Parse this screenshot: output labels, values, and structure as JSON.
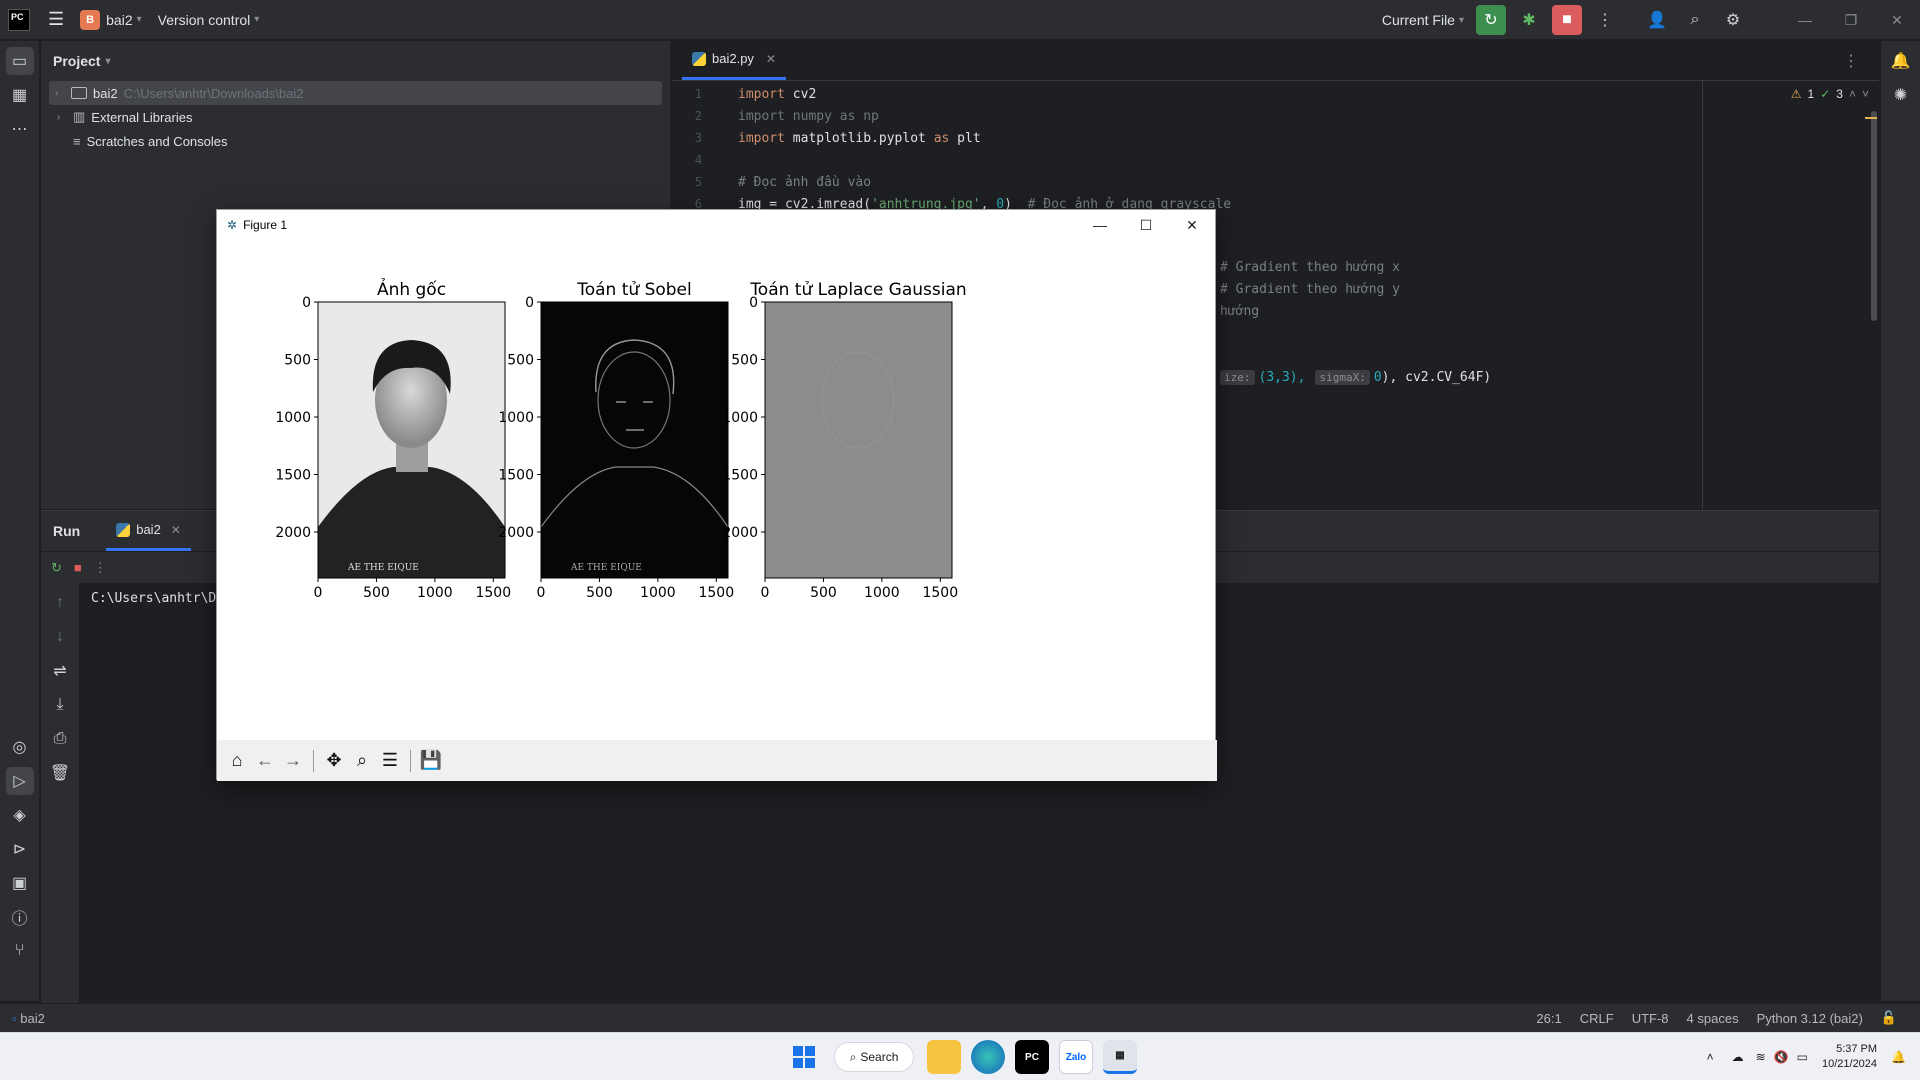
{
  "titlebar": {
    "project_badge": "B",
    "project_name": "bai2",
    "vcs": "Version control",
    "run_config": "Current File"
  },
  "project_panel": {
    "title": "Project",
    "items": [
      {
        "label": "bai2",
        "path": "C:\\Users\\anhtr\\Downloads\\bai2"
      },
      {
        "label": "External Libraries"
      },
      {
        "label": "Scratches and Consoles"
      }
    ]
  },
  "editor": {
    "tab": "bai2.py",
    "inspections": {
      "warnings": "1",
      "ok": "3"
    },
    "lines": [
      {
        "n": "1",
        "parts": [
          [
            "kw",
            "import"
          ],
          [
            "plain",
            " cv2"
          ]
        ]
      },
      {
        "n": "2",
        "parts": [
          [
            "dim",
            "import numpy as np"
          ]
        ]
      },
      {
        "n": "3",
        "parts": [
          [
            "kw",
            "import"
          ],
          [
            "plain",
            " matplotlib.pyplot "
          ],
          [
            "kw",
            "as"
          ],
          [
            "plain",
            " plt"
          ]
        ]
      },
      {
        "n": "4",
        "parts": []
      },
      {
        "n": "5",
        "parts": [
          [
            "cm",
            "# Đọc ảnh đầu vào"
          ]
        ]
      },
      {
        "n": "6",
        "parts": [
          [
            "plain",
            "img = cv2.imread("
          ],
          [
            "str",
            "'anhtrung.jpg'"
          ],
          [
            "plain",
            ", "
          ],
          [
            "num",
            "0"
          ],
          [
            "plain",
            ")  "
          ],
          [
            "cm",
            "# Đọc ảnh ở dạng grayscale"
          ]
        ]
      }
    ],
    "hidden_fragments": {
      "gx_comment": "# Gradient theo hướng x",
      "gy_comment": "# Gradient theo hướng y",
      "dir_comment": "hướng",
      "ksize_hint": "ize:",
      "ksize_val": "(3,3),",
      "sigma_hint": "sigmaX:",
      "sigma_tail_num": "0",
      "sigma_tail": "), cv2.CV_64F)"
    }
  },
  "run_panel": {
    "title": "Run",
    "tab": "bai2",
    "output": "C:\\Users\\anhtr\\D"
  },
  "figure": {
    "window_title": "Figure 1",
    "chart_data": [
      {
        "type": "image",
        "title": "Ảnh gốc",
        "xticks": [
          "0",
          "500",
          "1000",
          "1500"
        ],
        "yticks": [
          "0",
          "500",
          "1000",
          "1500",
          "2000"
        ],
        "xlim": [
          0,
          1600
        ],
        "ylim": [
          2400,
          0
        ]
      },
      {
        "type": "image",
        "title": "Toán tử Sobel",
        "xticks": [
          "0",
          "500",
          "1000",
          "1500"
        ],
        "yticks": [
          "0",
          "500",
          "1000",
          "1500",
          "2000"
        ],
        "xlim": [
          0,
          1600
        ],
        "ylim": [
          2400,
          0
        ]
      },
      {
        "type": "image",
        "title": "Toán tử Laplace Gaussian",
        "xticks": [
          "0",
          "500",
          "1000",
          "1500"
        ],
        "yticks": [
          "0",
          "500",
          "1000",
          "1500",
          "2000"
        ],
        "xlim": [
          0,
          1600
        ],
        "ylim": [
          2400,
          0
        ]
      }
    ],
    "shirt_text": "AE THE EIQUE"
  },
  "statusbar": {
    "project": "bai2",
    "position": "26:1",
    "line_sep": "CRLF",
    "encoding": "UTF-8",
    "indent": "4 spaces",
    "interpreter": "Python 3.12 (bai2)"
  },
  "taskbar": {
    "search": "Search",
    "time": "5:37 PM",
    "date": "10/21/2024",
    "zalo": "Zalo"
  }
}
